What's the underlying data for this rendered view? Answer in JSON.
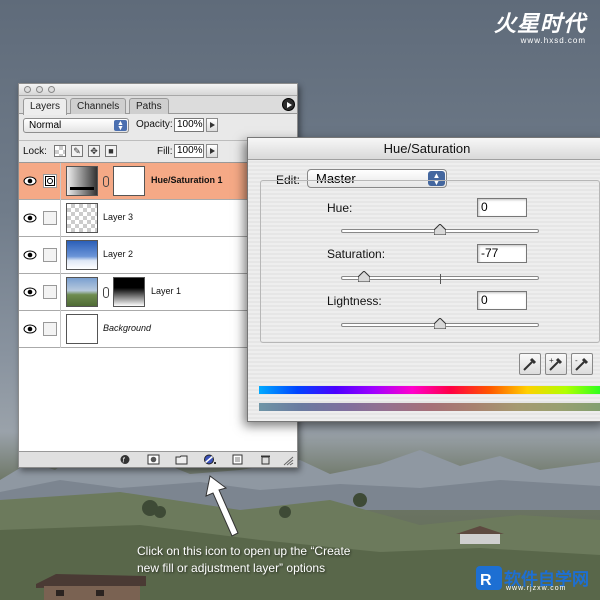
{
  "watermark": {
    "brand": "火星时代",
    "url": "www.hxsd.com",
    "bottom_logo": "软件自学网",
    "bottom_url": "www.rjzxw.com"
  },
  "layers_panel": {
    "tabs": [
      "Layers",
      "Channels",
      "Paths"
    ],
    "active_tab": "Layers",
    "blend_mode": "Normal",
    "opacity_label": "Opacity:",
    "opacity_value": "100%",
    "lock_label": "Lock:",
    "fill_label": "Fill:",
    "fill_value": "100%",
    "layers": [
      {
        "name": "Hue/Saturation 1",
        "selected": true
      },
      {
        "name": "Layer 3"
      },
      {
        "name": "Layer 2"
      },
      {
        "name": "Layer 1"
      },
      {
        "name": "Background"
      }
    ]
  },
  "dialog": {
    "title": "Hue/Saturation",
    "edit_label": "Edit:",
    "edit_value": "Master",
    "hue_label": "Hue:",
    "hue_value": "0",
    "saturation_label": "Saturation:",
    "saturation_value": "-77",
    "lightness_label": "Lightness:",
    "lightness_value": "0"
  },
  "annotation": {
    "line1": "Click on this icon to open up the “Create",
    "line2": "new fill or adjustment layer” options"
  }
}
